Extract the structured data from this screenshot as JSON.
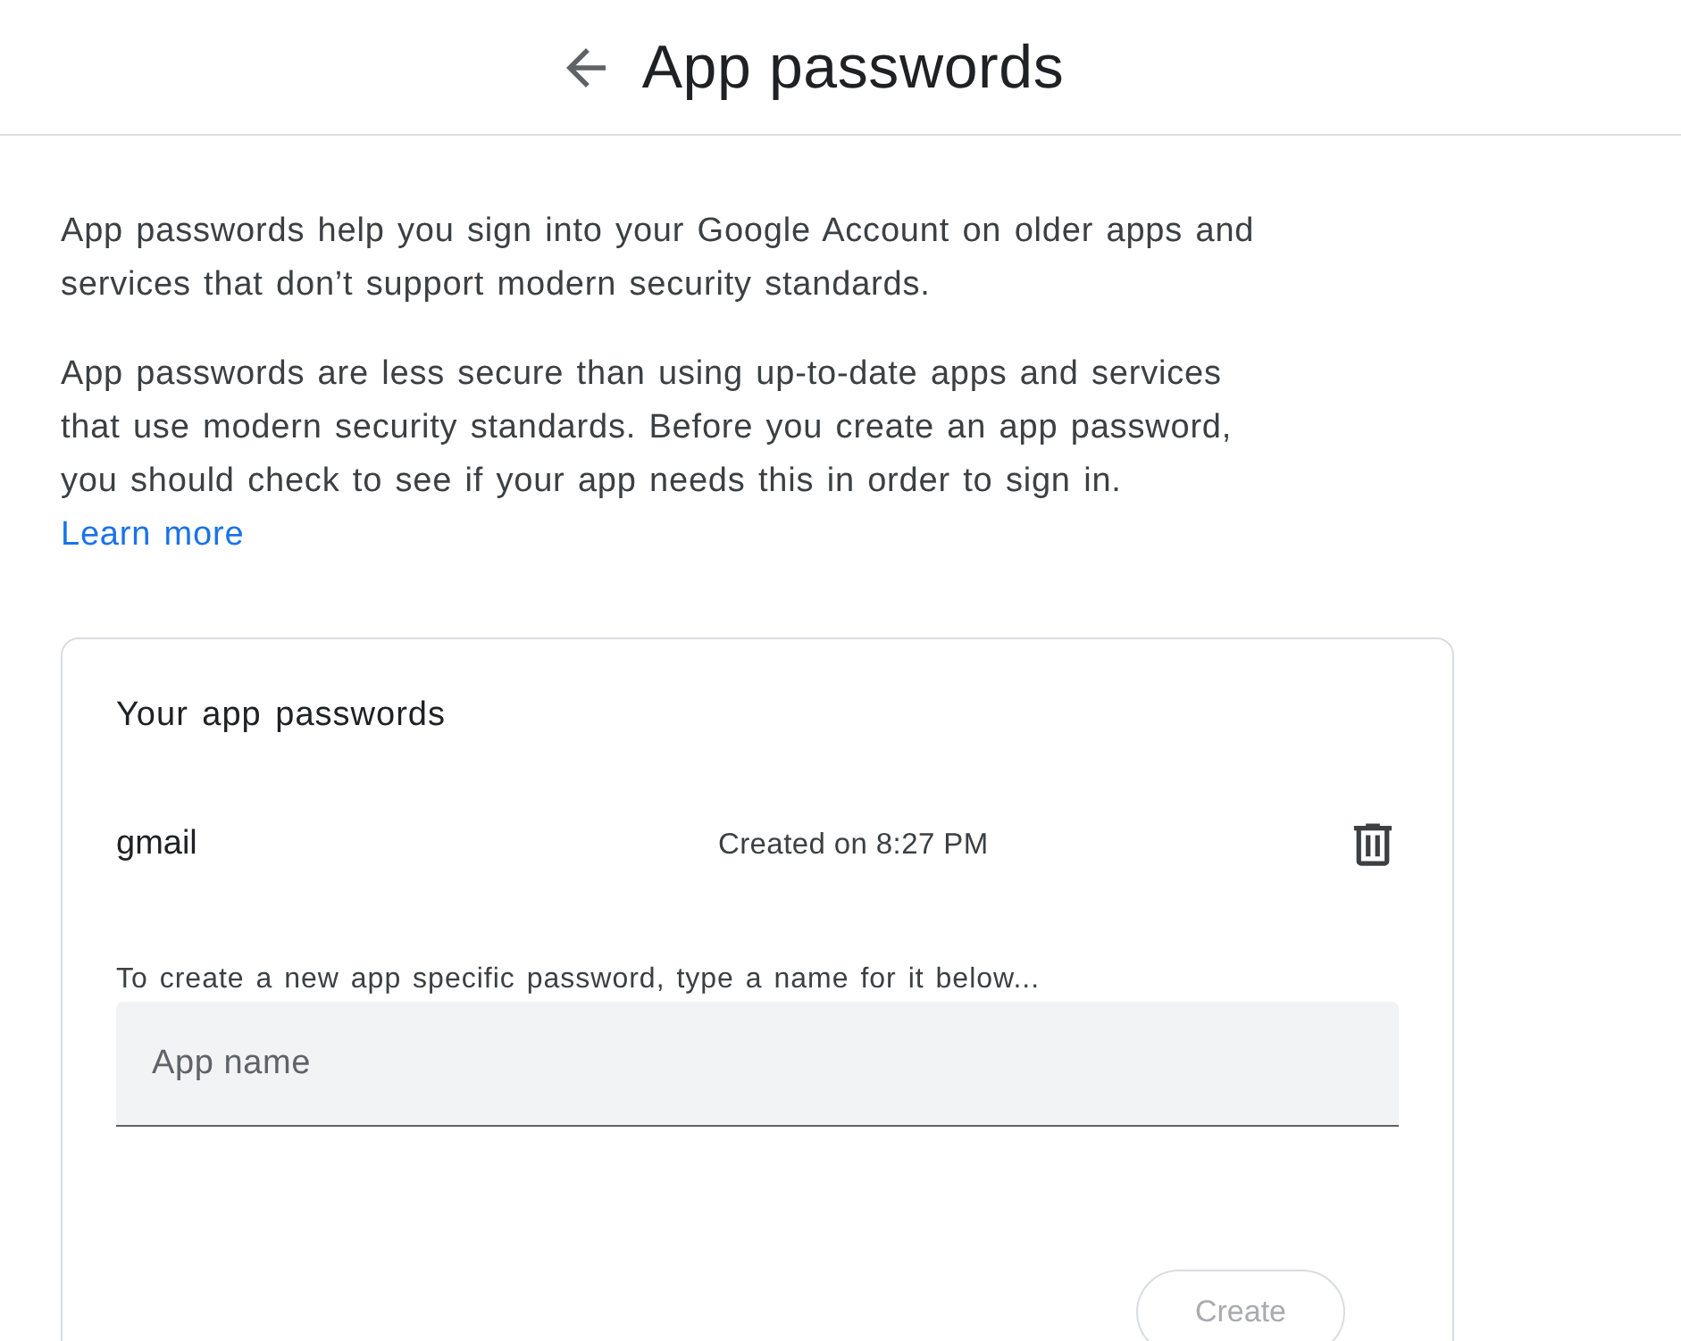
{
  "header": {
    "title": "App passwords"
  },
  "intro": {
    "paragraphs": [
      "App passwords help you sign into your Google Account on older apps and services that don’t support modern security standards.",
      "App passwords are less secure than using up-to-date apps and services that use modern security standards. Before you create an app password, you should check to see if your app needs this in order to sign in."
    ],
    "link": "Learn more"
  },
  "card": {
    "title": "Your app passwords",
    "passwords": [
      {
        "name": "gmail",
        "created": "Created on 8:27 PM"
      }
    ],
    "create_hint": "To create a new app specific password, type a name for it below...",
    "app_name_field": {
      "placeholder": "App name"
    },
    "create_button": {
      "label": "Create",
      "disabled": true
    }
  }
}
